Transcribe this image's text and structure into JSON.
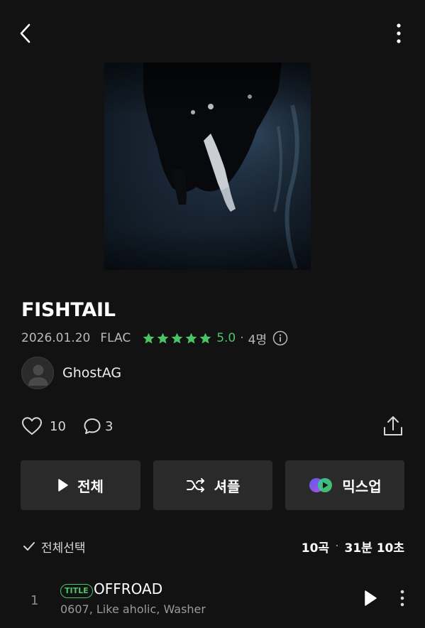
{
  "album": {
    "title": "FISHTAIL",
    "release_date": "2026.01.20",
    "format": "FLAC",
    "rating": "5.0",
    "rating_value": 5,
    "rating_count": "4명",
    "artist": "GhostAG"
  },
  "social": {
    "likes": "10",
    "comments": "3"
  },
  "actions": {
    "play_all": "전체",
    "shuffle": "셔플",
    "mixup": "믹스업"
  },
  "list_header": {
    "select_all": "전체선택",
    "track_count": "10곡",
    "duration": "31분 10초"
  },
  "tracks": [
    {
      "number": "1",
      "badge": "TITLE",
      "title": "OFFROAD",
      "artists": "0607, Like aholic, Washer"
    }
  ],
  "colors": {
    "background": "#121212",
    "accent_green": "#4ac565",
    "button_bg": "#2a2a2a"
  },
  "icons": {
    "back": "chevron-left-icon",
    "more": "more-vertical-icon",
    "info": "info-icon",
    "like": "heart-icon",
    "comment": "comment-icon",
    "share": "share-icon",
    "play": "play-icon",
    "shuffle": "shuffle-icon",
    "mixup": "mixup-icon",
    "check": "check-icon"
  }
}
